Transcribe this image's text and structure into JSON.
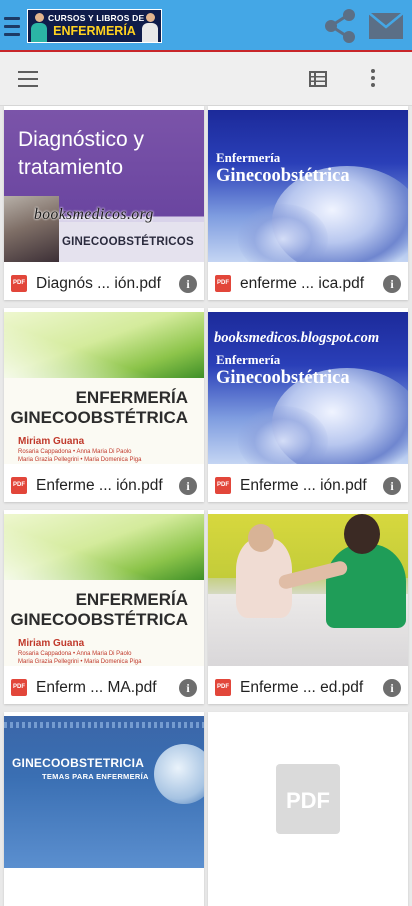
{
  "app_bar": {
    "banner_line1": "CURSOS Y LIBROS DE",
    "banner_line2": "ENFERMERÍA",
    "icons": [
      "menu-icon",
      "share-icon",
      "mail-icon"
    ],
    "colors": {
      "background": "#44a7e6",
      "accent_line": "#c8262a",
      "banner": "#0f1c4a",
      "banner_text": "#ffd21f"
    }
  },
  "toolbar": {
    "icons": [
      "menu-icon",
      "list-view-icon",
      "more-vert-icon"
    ]
  },
  "files": [
    {
      "name": "Diagnós ... ión.pdf",
      "cover_title": "Diagnóstico y tratamiento",
      "cover_subtitle": "GINECOOBSTÉTRICOS",
      "watermark": "booksmedicos.org"
    },
    {
      "name": "enferme ... ica.pdf",
      "cover_line1": "Enfermería",
      "cover_line2": "Ginecoobstétrica"
    },
    {
      "name": "Enferme ... ión.pdf",
      "cover_title_1": "ENFERMERÍA",
      "cover_title_2": "GINECOOBSTÉTRICA",
      "cover_author": "Miriam Guana",
      "cover_coauthors": "Rosaria Cappadona • Anna Maria Di Paolo\nMaria Grazia Pellegrini • Maria Domenica Piga"
    },
    {
      "name": "Enferme ... ión.pdf",
      "cover_site": "booksmedicos.blogspot.com",
      "cover_line1": "Enfermería",
      "cover_line2": "Ginecoobstétrica"
    },
    {
      "name": "Enferm ... MA.pdf",
      "cover_title_1": "ENFERMERÍA",
      "cover_title_2": "GINECOOBSTÉTRICA",
      "cover_author": "Miriam Guana",
      "cover_coauthors": "Rosaria Cappadona • Anna Maria Di Paolo\nMaria Grazia Pellegrini • Maria Domenica Piga"
    },
    {
      "name": "Enferme ... ed.pdf"
    },
    {
      "cover_title": "GINECOOBSTETRICIA",
      "cover_subtitle": "TEMAS PARA ENFERMERÍA"
    },
    {
      "placeholder": "PDF"
    }
  ],
  "file_badge": "PDF",
  "info_glyph": "i"
}
